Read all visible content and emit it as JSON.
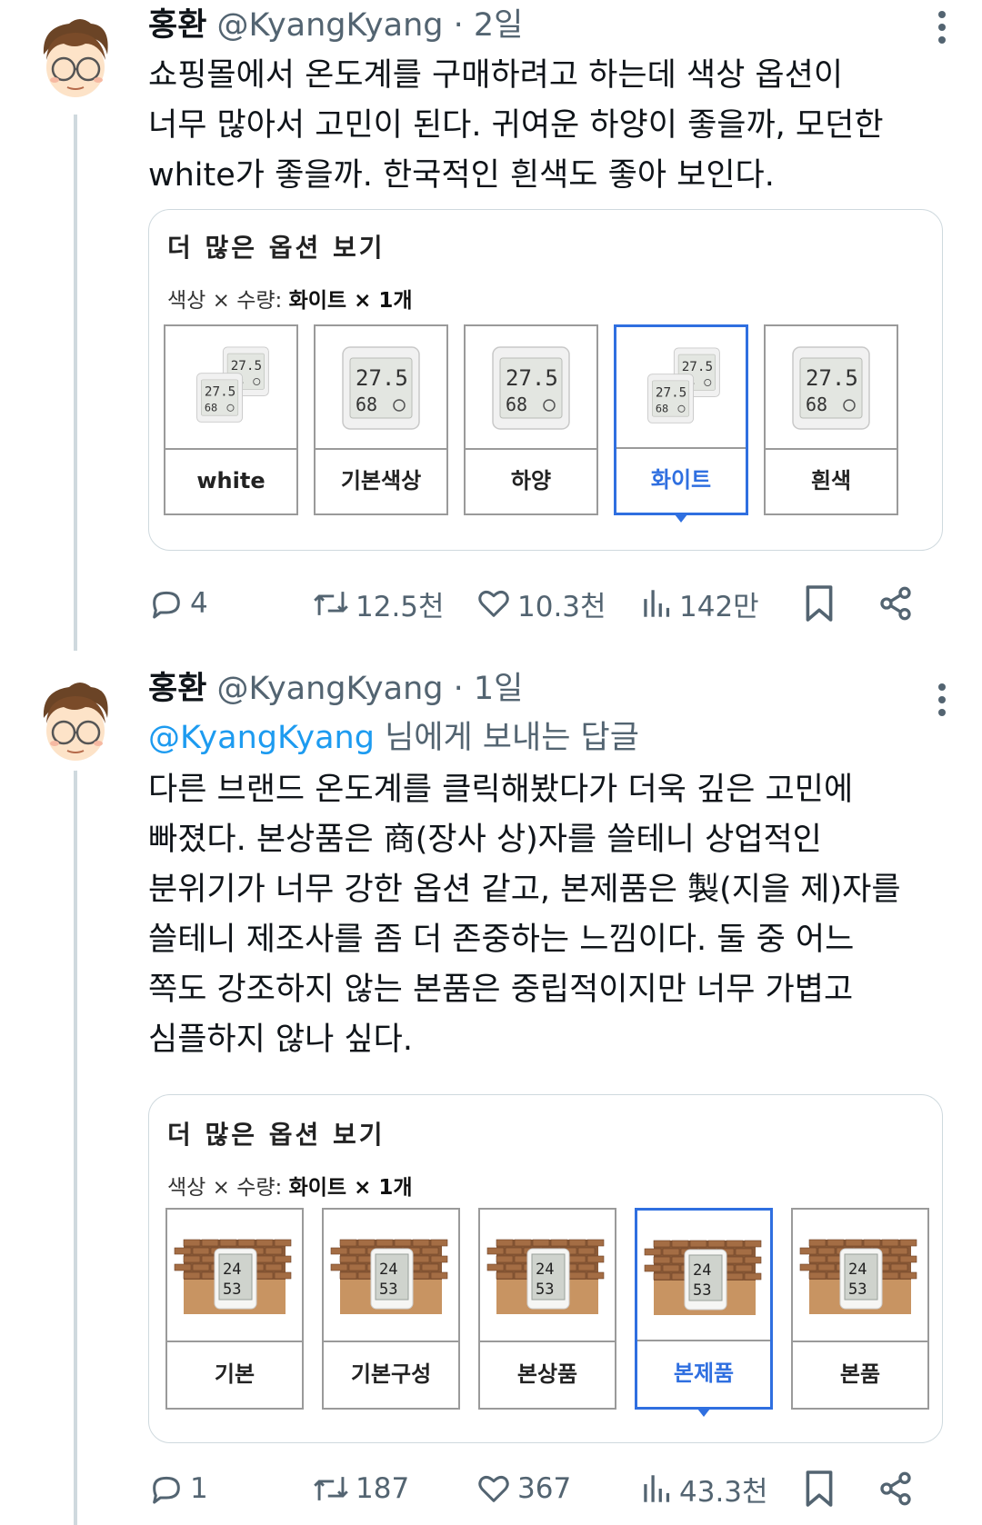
{
  "tweets": [
    {
      "name": "홍환",
      "handle": "@KyangKyang",
      "dot": "·",
      "time": "2일",
      "text_lines": [
        "쇼핑몰에서 온도계를 구매하려고 하는데 색상 옵션이",
        "너무 많아서 고민이 된다. 귀여운 하양이 좋을까, 모던한",
        "white가 좋을까. 한국적인 흰색도 좋아 보인다."
      ],
      "card": {
        "title": "더 많은 옵션 보기",
        "sub_prefix": "색상 × 수량: ",
        "sub_value": "화이트 × 1개",
        "options": [
          {
            "label": "white",
            "selected": false,
            "icon": "thermometer-duo-icon"
          },
          {
            "label": "기본색상",
            "selected": false,
            "icon": "thermometer-icon"
          },
          {
            "label": "하양",
            "selected": false,
            "icon": "thermometer-icon"
          },
          {
            "label": "화이트",
            "selected": true,
            "icon": "thermometer-duo-icon"
          },
          {
            "label": "흰색",
            "selected": false,
            "icon": "thermometer-icon"
          }
        ],
        "display_temp": "27.5",
        "display_hum": "68"
      },
      "actions": {
        "replies": "4",
        "retweets": "12.5천",
        "likes": "10.3천",
        "views": "142만"
      }
    },
    {
      "name": "홍환",
      "handle": "@KyangKyang",
      "dot": "·",
      "time": "1일",
      "reply_mention": "@KyangKyang",
      "reply_suffix": " 님에게 보내는 답글",
      "text_lines": [
        "다른 브랜드 온도계를 클릭해봤다가 더욱 깊은 고민에",
        "빠졌다. 본상품은 商(장사 상)자를 쓸테니 상업적인",
        "분위기가 너무 강한 옵션 같고, 본제품은 製(지을 제)자를",
        "쓸테니 제조사를 좀 더 존중하는 느낌이다. 둘 중 어느",
        "쪽도 강조하지 않는 본품은 중립적이지만 너무 가볍고",
        "심플하지 않나 싶다."
      ],
      "card": {
        "title": "더 많은 옵션 보기",
        "sub_prefix": "색상 × 수량: ",
        "sub_value": "화이트 × 1개",
        "options": [
          {
            "label": "기본",
            "selected": false,
            "icon": "thermometer-photo-icon"
          },
          {
            "label": "기본구성",
            "selected": false,
            "icon": "thermometer-photo-icon"
          },
          {
            "label": "본상품",
            "selected": false,
            "icon": "thermometer-photo-icon"
          },
          {
            "label": "본제품",
            "selected": true,
            "icon": "thermometer-photo-icon"
          },
          {
            "label": "본품",
            "selected": false,
            "icon": "thermometer-photo-icon"
          }
        ],
        "display_temp": "24",
        "display_hum": "53"
      },
      "actions": {
        "replies": "1",
        "retweets": "187",
        "likes": "367",
        "views": "43.3천"
      }
    }
  ],
  "colors": {
    "text": "#0f1419",
    "secondary": "#536471",
    "link": "#1d9bf0",
    "selected_option": "#2f6fe0",
    "thread_line": "#cfd9de"
  }
}
